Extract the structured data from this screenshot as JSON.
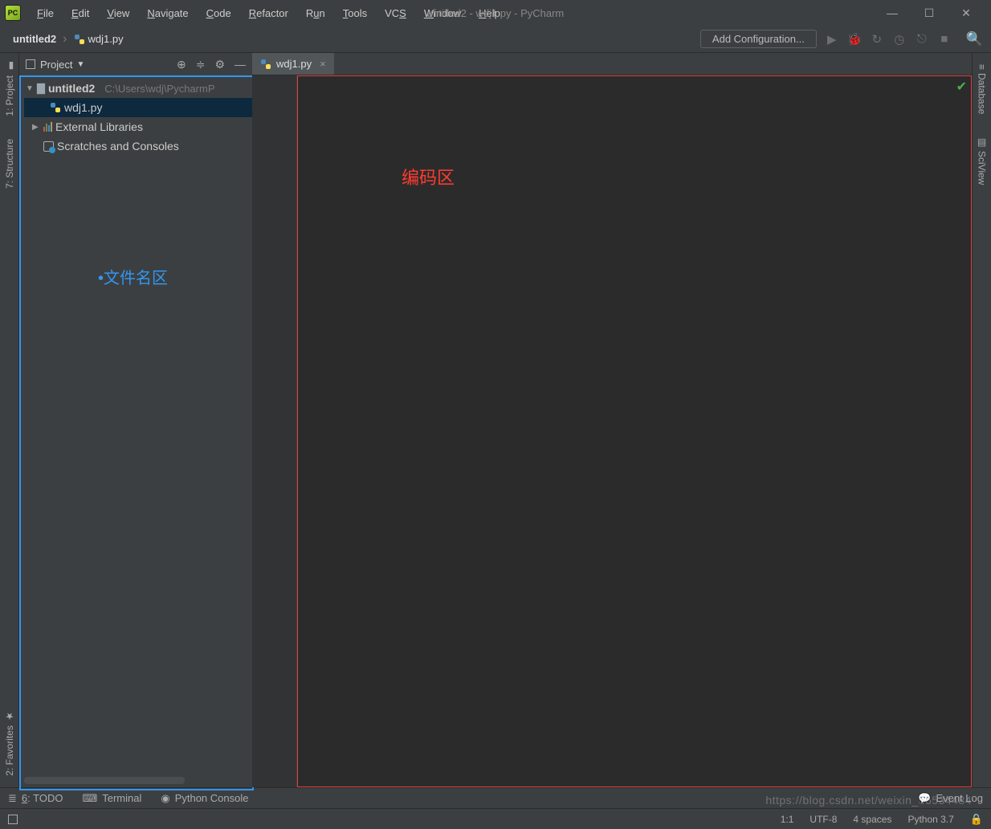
{
  "window": {
    "title": "untitled2 - wdj1.py - PyCharm"
  },
  "menu": [
    "File",
    "Edit",
    "View",
    "Navigate",
    "Code",
    "Refactor",
    "Run",
    "Tools",
    "VCS",
    "Window",
    "Help"
  ],
  "breadcrumb": {
    "root": "untitled2",
    "file": "wdj1.py"
  },
  "toolbar": {
    "add_configuration": "Add Configuration..."
  },
  "project_panel": {
    "title": "Project",
    "root": {
      "name": "untitled2",
      "path": "C:\\Users\\wdj\\PycharmP"
    },
    "file": "wdj1.py",
    "external_libraries": "External Libraries",
    "scratches": "Scratches and Consoles"
  },
  "annotations": {
    "filename_area": "•文件名区",
    "code_area": "编码区"
  },
  "editor_tab": {
    "file": "wdj1.py"
  },
  "left_rail": {
    "project": "1: Project",
    "structure": "7: Structure",
    "favorites": "2: Favorites"
  },
  "right_rail": {
    "database": "Database",
    "sciview": "SciView"
  },
  "toolwindows": {
    "todo": "6: TODO",
    "terminal": "Terminal",
    "python_console": "Python Console",
    "event_log": "Event Log"
  },
  "status": {
    "position": "1:1",
    "encoding": "UTF-8",
    "indent": "4 spaces",
    "python": "Python 3.7"
  },
  "watermark": "https://blog.csdn.net/weixin_56534484"
}
